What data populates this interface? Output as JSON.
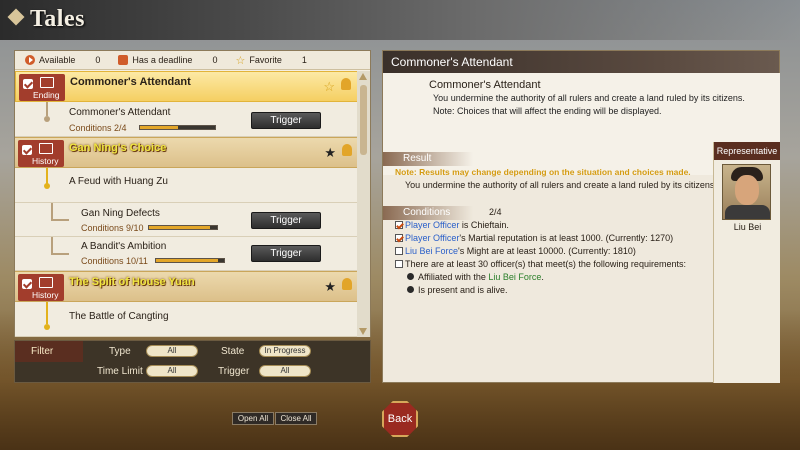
{
  "screen": {
    "title": "Tales"
  },
  "stats": {
    "available_label": "Available",
    "available_count": "0",
    "deadline_label": "Has a deadline",
    "deadline_count": "0",
    "favorite_label": "Favorite",
    "favorite_count": "1"
  },
  "tales": {
    "cat1": {
      "badge": "Ending",
      "name": "Commoner's Attendant"
    },
    "item1": {
      "name": "Commoner's Attendant",
      "cond_label": "Conditions",
      "cond_value": "2/4",
      "progress": 0.5,
      "button": "Trigger"
    },
    "cat2": {
      "badge": "History",
      "name": "Gan Ning's Choice"
    },
    "item2": {
      "name": "A Feud with Huang Zu"
    },
    "item3": {
      "name": "Gan Ning Defects",
      "cond_label": "Conditions",
      "cond_value": "9/10",
      "progress": 0.9,
      "button": "Trigger"
    },
    "item4": {
      "name": "A Bandit's Ambition",
      "cond_label": "Conditions",
      "cond_value": "10/11",
      "progress": 0.91,
      "button": "Trigger"
    },
    "cat3": {
      "badge": "History",
      "name": "The Split of House Yuan"
    },
    "item5": {
      "name": "The Battle of Cangting"
    }
  },
  "filter": {
    "title": "Filter",
    "type_label": "Type",
    "type_value": "All",
    "state_label": "State",
    "state_value": "In Progress",
    "time_label": "Time Limit",
    "time_value": "All",
    "trigger_label": "Trigger",
    "trigger_value": "All"
  },
  "detail": {
    "header": "Commoner's Attendant",
    "subtitle": "Commoner's Attendant",
    "desc1": "You undermine the authority of all rulers and create a land ruled by its citizens.",
    "desc2": "Note: Choices that will affect the ending will be displayed.",
    "result_label": "Result",
    "result_note": "Note: Results may change depending on the situation and choices made.",
    "result_text": "You undermine the authority of all rulers and create a land ruled by its citizens.",
    "conditions_label": "Conditions",
    "conditions_count": "2/4",
    "c1_a": "Player Officer",
    "c1_b": " is Chieftain.",
    "c2_a": "Player Officer",
    "c2_b": "'s Martial reputation is at least 1000. (Currently: 1270)",
    "c3_a": "Liu Bei Force",
    "c3_b": "'s Might are at least 10000. (Currently: 1810)",
    "c4": "There are at least 30 officer(s) that meet(s) the following requirements:",
    "c4_1a": "Affiliated with the ",
    "c4_1b": "Liu Bei Force",
    "c4_1c": ".",
    "c4_2": "Is present and is alive."
  },
  "representative": {
    "label": "Representative",
    "name": "Liu Bei"
  },
  "footer": {
    "open_all": "Open All",
    "close_all": "Close All",
    "back": "Back"
  },
  "colors": {
    "accent_gold": "#f5cf62",
    "badge_red": "#a23d2c",
    "condition_blue": "#2a5fc9",
    "force_green": "#2a7f2a",
    "note_orange": "#d49b12"
  }
}
